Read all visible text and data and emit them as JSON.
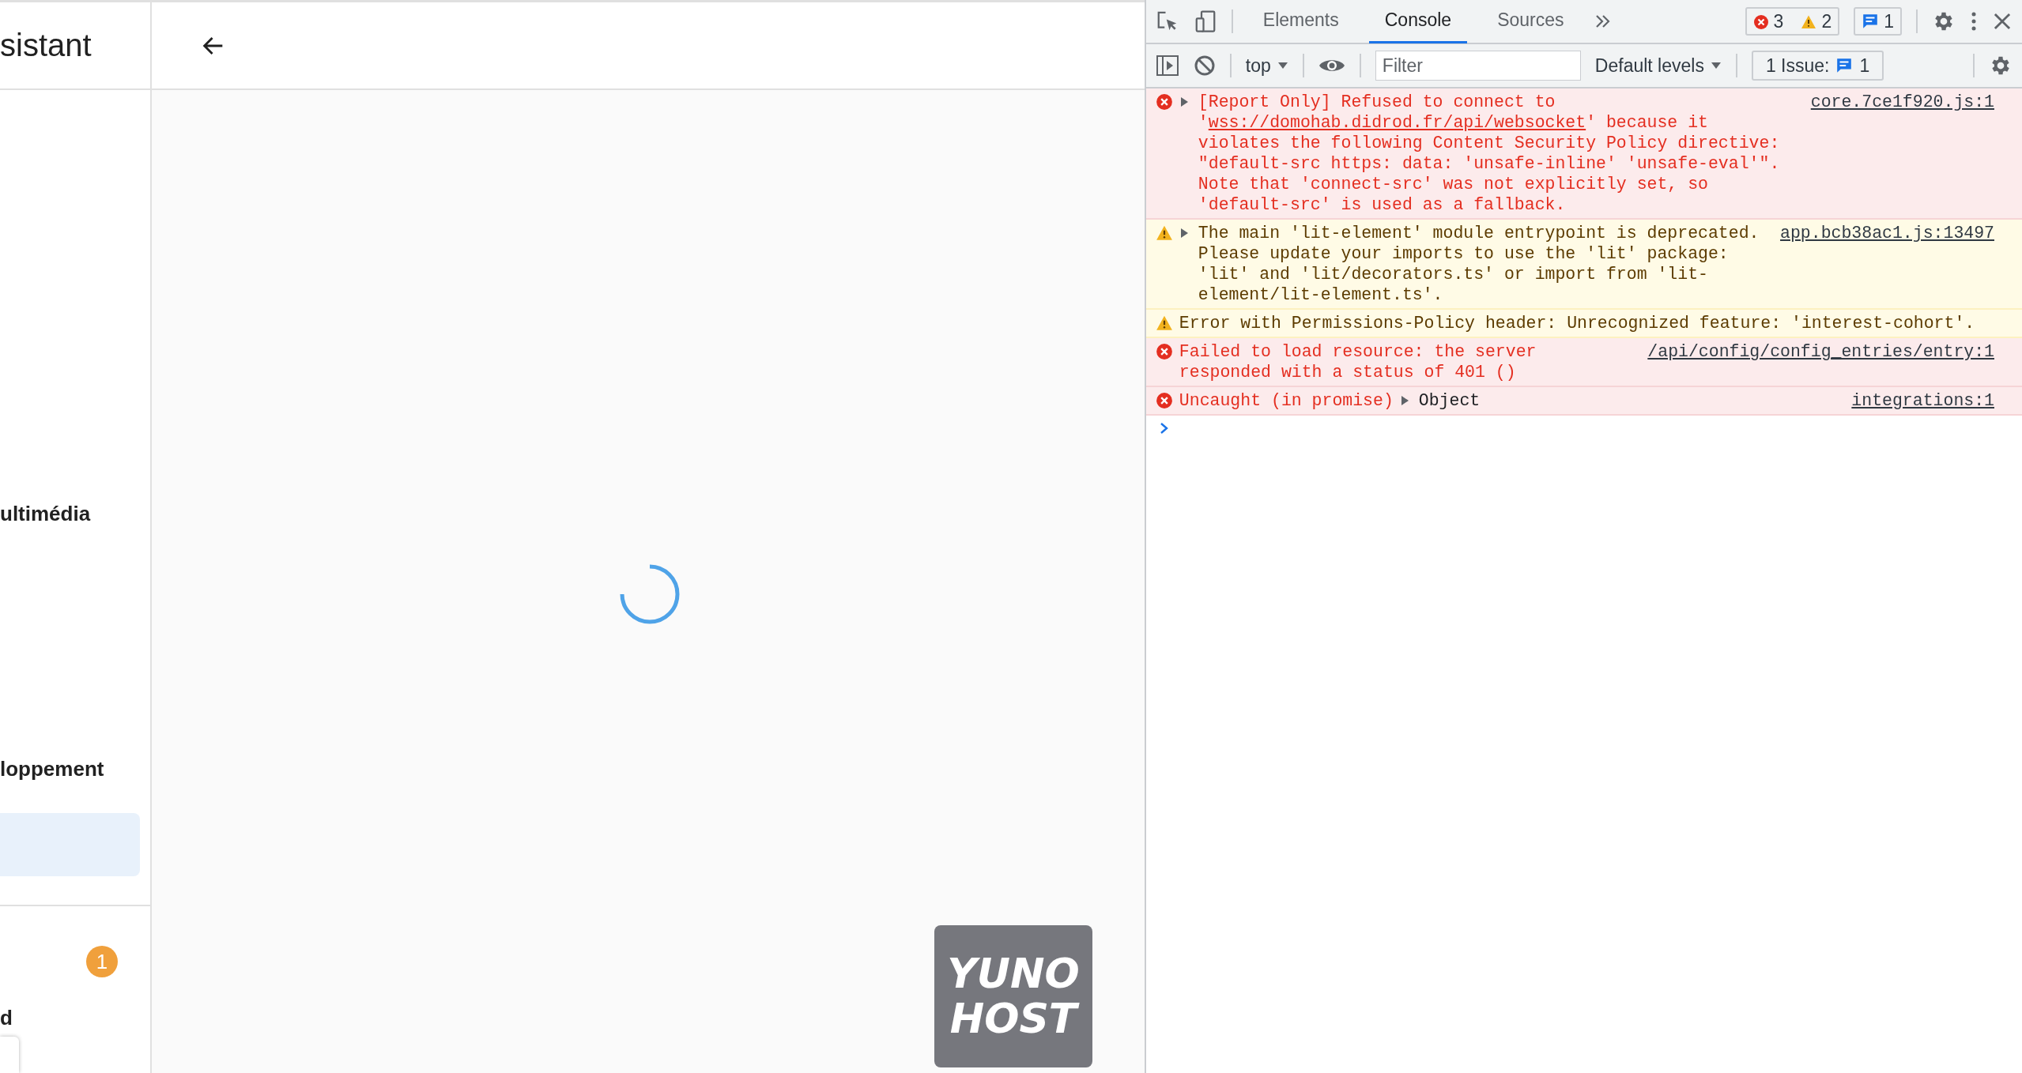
{
  "sidebar": {
    "title": "sistant",
    "items": [
      {
        "label": "ultimédia",
        "selected": false
      },
      {
        "label": "loppement",
        "selected": false
      },
      {
        "selected": true
      }
    ],
    "notification_badge": "1",
    "cut_label": "d"
  },
  "main": {
    "loading": true,
    "logo": {
      "lines": [
        "YUNO",
        "HOST"
      ]
    }
  },
  "devtools": {
    "tabs": [
      {
        "label": "Elements",
        "selected": false
      },
      {
        "label": "Console",
        "selected": true
      },
      {
        "label": "Sources",
        "selected": false
      }
    ],
    "counters": {
      "errors": "3",
      "warnings": "2",
      "messages": "1"
    },
    "console_toolbar": {
      "context": "top",
      "filter_placeholder": "Filter",
      "levels": "Default levels",
      "issues_label": "1 Issue:",
      "issues_count": "1"
    },
    "messages": [
      {
        "kind": "error",
        "expandable": true,
        "text_before": "[Report Only] Refused to connect to '",
        "url": "wss://domohab.didrod.fr/api/websocket",
        "text_after": "' because it violates the following Content Security Policy directive: \"default-src https: data: 'unsafe-inline' 'unsafe-eval'\". Note that 'connect-src' was not explicitly set, so 'default-src' is used as a fallback.",
        "source": "core.7ce1f920.js:1"
      },
      {
        "kind": "warning",
        "expandable": true,
        "text_before": "The main 'lit-element' module entrypoint is deprecated. Please update your imports to use the 'lit' package: 'lit' and 'lit/decorators.ts' or import from 'lit-element/lit-element.ts'.",
        "source": "app.bcb38ac1.js:13497"
      },
      {
        "kind": "warning",
        "expandable": false,
        "text_before": "Error with Permissions-Policy header: Unrecognized feature: 'interest-cohort'."
      },
      {
        "kind": "error",
        "expandable": false,
        "text_before": "Failed to load resource: the server responded with a status of 401 ()",
        "source": "/api/config/config_entries/entry:1"
      },
      {
        "kind": "error",
        "expandable": false,
        "text_before": "Uncaught (in promise)",
        "object": "Object",
        "source": "integrations:1"
      }
    ]
  }
}
